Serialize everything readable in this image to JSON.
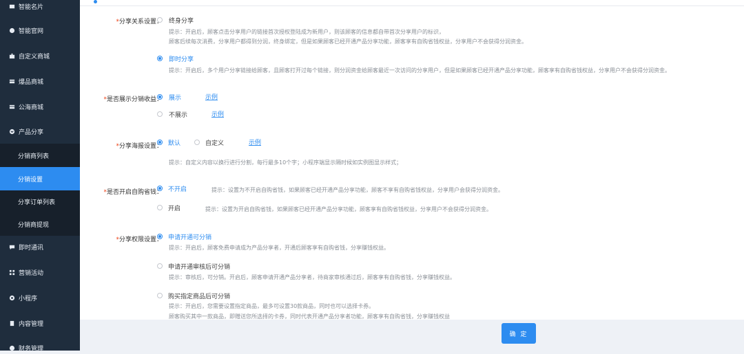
{
  "sidebar": {
    "items": [
      {
        "label": "智能名片",
        "icon": "card-icon"
      },
      {
        "label": "智能官网",
        "icon": "globe-icon"
      },
      {
        "label": "自定义商城",
        "icon": "puzzle-icon"
      },
      {
        "label": "爆品商城",
        "icon": "shop-icon"
      },
      {
        "label": "公海商城",
        "icon": "shop-icon"
      },
      {
        "label": "产品分享",
        "icon": "share-icon"
      }
    ],
    "sub_items": [
      {
        "label": "分销商列表",
        "active": false
      },
      {
        "label": "分销设置",
        "active": true
      },
      {
        "label": "分享订单列表",
        "active": false
      },
      {
        "label": "分销商提现",
        "active": false
      }
    ],
    "bottom_items": [
      {
        "label": "即时通讯",
        "icon": "chat-icon"
      },
      {
        "label": "营销活动",
        "icon": "grid-icon"
      },
      {
        "label": "小程序",
        "icon": "miniapp-icon"
      },
      {
        "label": "内容管理",
        "icon": "document-icon"
      },
      {
        "label": "财务管理",
        "icon": "finance-icon"
      }
    ]
  },
  "form": {
    "relation": {
      "label": "分享关系设置：",
      "opt1": "终身分享",
      "tip1a": "提示：开启后，顾客点击分享用户的链接首次授权登陆成为新用户，则该顾客的信息都自带首次分享用户的标识，",
      "tip1b": "顾客后续每次消费，分享用户都得到分润，终身绑定，但是如果顾客已经开通产品分享功能，顾客享有自购省钱权益，分享用户不会获得分润资金。",
      "opt2": "即时分享",
      "tip2": "提示：开启后，多个用户分享链接给顾客，且顾客打开过每个链接，则分润资金给顾客最近一次访问的分享用户，但是如果顾客已经开通产品分享功能，顾客享有自购省钱权益，分享用户不会获得分润资金。"
    },
    "show_income": {
      "label": "是否展示分销收益：",
      "opt1": "展示",
      "opt2": "不展示",
      "example": "示例"
    },
    "poster": {
      "label": "分享海报设置：",
      "opt1": "默认",
      "opt2": "自定义",
      "example": "示例",
      "tip": "提示：自定义内容以换行进行分割，每行最多10个字；小程序端显示隔时候如实例图显示样式；"
    },
    "self_buy": {
      "label": "是否开启自购省钱：",
      "opt1": "不开启",
      "tip1": "提示：设置为不开启自购省钱，如果顾客已经开通产品分享功能，顾客不享有自购省钱权益，分享用户会获得分润资金。",
      "opt2": "开启",
      "tip2": "提示：设置为开启自购省钱，如果顾客已经开通产品分享功能，顾客享有自购省钱权益，分享用户不会获得分润资金。"
    },
    "permission": {
      "label": "分享权限设置：",
      "opt1": "申请开通可分销",
      "tip1": "提示：开启后，顾客免费申请成为产品分享者，开通后顾客享有自购省钱，分享赚钱权益。",
      "opt2": "申请开通审核后可分销",
      "tip2": "提示：审核后，可分销。开启后，顾客申请开通产品分享者，待商家审核通过后，顾客享有自购省钱，分享赚钱权益。",
      "opt3": "购买指定商品后可分销",
      "tip3a": "提示：开启后，您需要设置指定商品，最多可设置30款商品，同时也可以选择卡券。",
      "tip3b": "顾客购买其中一款商品，即赠送您所选择的卡券，同时代表开通产品分享者功能，顾客享有自购省钱，分享赚钱权益"
    },
    "required_mark": "*"
  },
  "footer": {
    "ok_label": "确 定"
  },
  "colors": {
    "accent": "#2d8cf0",
    "sidebar_bg": "#1f2d3d",
    "required": "#ed4014"
  }
}
